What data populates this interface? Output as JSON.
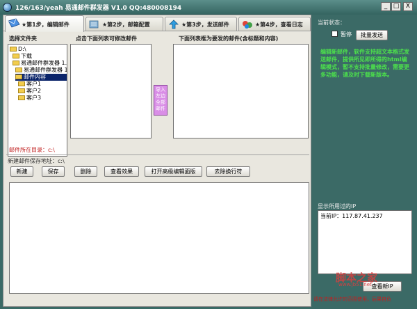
{
  "window": {
    "title": "126/163/yeah 易通邮件群发器 V1.0   QQ:480008194",
    "min": "_",
    "max": "□",
    "close": "X"
  },
  "tabs": [
    {
      "label": "★第1步，编辑邮件",
      "active": true
    },
    {
      "label": "★第2步，邮箱配置",
      "active": false
    },
    {
      "label": "★第3步，发送邮件",
      "active": false
    },
    {
      "label": "★第4步，查看日志",
      "active": false
    }
  ],
  "edit": {
    "folder_label": "选择文件夹",
    "list_label": "点击下面列表可修改邮件",
    "send_label": "下面列表框为要发的邮件(含标题和内容)",
    "import_button": "导入左边全部邮件",
    "tree": [
      {
        "label": "D:\\",
        "level": 0,
        "selected": false
      },
      {
        "label": "下载",
        "level": 1,
        "selected": false
      },
      {
        "label": "易通邮件群发器 1.0",
        "level": 1,
        "selected": false
      },
      {
        "label": "易通邮件群发器 1.",
        "level": 2,
        "selected": false
      },
      {
        "label": "邮件内容",
        "level": 2,
        "selected": true
      },
      {
        "label": "客户1",
        "level": 3,
        "selected": false
      },
      {
        "label": "客户2",
        "level": 3,
        "selected": false
      },
      {
        "label": "客户3",
        "level": 3,
        "selected": false
      }
    ],
    "mail_dir_text": "邮件所在目录：c:\\",
    "new_mail_dir_text": "新建邮件保存地址：c:\\",
    "buttons": [
      "新建",
      "保存",
      "删除",
      "查看效果",
      "打开高级编辑面版",
      "去除换行符"
    ]
  },
  "side": {
    "status_label": "当前状态：",
    "pause_label": "暂停",
    "batch_button": "批量发送",
    "notice": "编辑新邮件，软件支持超文本格式发送邮件，提供所见即所得的html编辑模式，暂不支持批量修改，需要更多功能，请及时下载新版本。",
    "ip_label": "显示所用过的IP",
    "ip_value": "当前IP：117.87.41.237",
    "view_ip_button": "查看新IP",
    "footer": "请在法律允许的范围使用，后果自负"
  },
  "watermark": {
    "text": "脚本之家",
    "url": "www.jb51.net"
  }
}
